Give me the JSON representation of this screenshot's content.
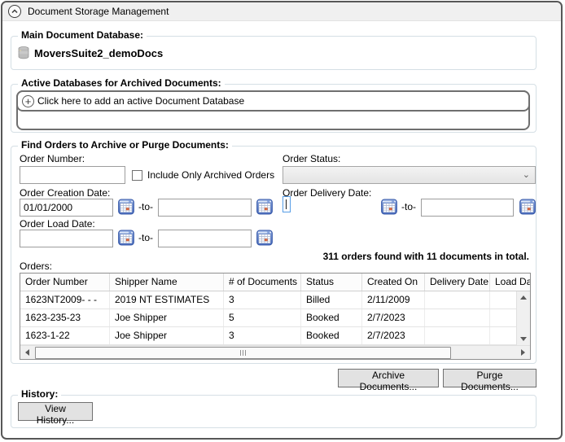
{
  "window": {
    "title": "Document Storage Management"
  },
  "main_db": {
    "label": "Main Document Database:",
    "value": "MoversSuite2_demoDocs"
  },
  "active_db": {
    "label": "Active Databases for Archived Documents:",
    "add_button": "Click here to add an active Document Database"
  },
  "find_orders": {
    "label": "Find Orders to Archive or Purge Documents:",
    "order_number_label": "Order Number:",
    "order_number_value": "",
    "include_archived_label": "Include Only Archived Orders",
    "order_status_label": "Order Status:",
    "order_status_value": "",
    "creation_date_label": "Order Creation Date:",
    "creation_from": "01/01/2000",
    "creation_to": "",
    "delivery_date_label": "Order Delivery Date:",
    "delivery_from": "",
    "delivery_to": "",
    "load_date_label": "Order Load Date:",
    "load_from": "",
    "load_to": "",
    "to_separator": "-to-",
    "results_summary": "311 orders found with 11 documents in total.",
    "orders_label": "Orders:"
  },
  "orders_table": {
    "columns": [
      "Order Number",
      "Shipper Name",
      "# of Documents",
      "Status",
      "Created On",
      "Delivery Date",
      "Load Date"
    ],
    "rows": [
      [
        "1623NT2009- - -",
        "2019 NT ESTIMATES",
        "3",
        "Billed",
        "2/11/2009",
        "",
        ""
      ],
      [
        "1623-235-23",
        "Joe Shipper",
        "5",
        "Booked",
        "2/7/2023",
        "",
        ""
      ],
      [
        "1623-1-22",
        "Joe Shipper",
        "3",
        "Booked",
        "2/7/2023",
        "",
        ""
      ]
    ]
  },
  "actions": {
    "archive": "Archive Documents...",
    "purge": "Purge Documents..."
  },
  "history": {
    "label": "History:",
    "view_button": "View History..."
  },
  "colors": {
    "focus_border": "#569de6",
    "group_border": "#d5dfe5",
    "calendar_blue": "#5b7fd0",
    "calendar_cell": "#e4764f"
  }
}
